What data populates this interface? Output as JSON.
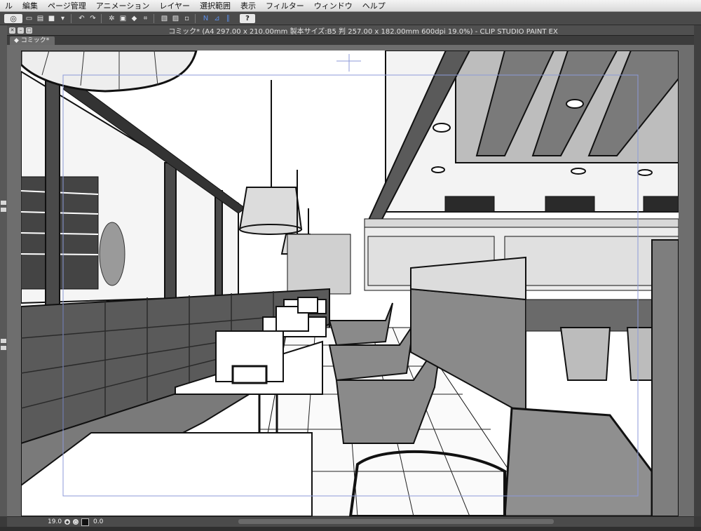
{
  "menu": [
    "ル",
    "編集",
    "ページ管理",
    "アニメーション",
    "レイヤー",
    "選択範囲",
    "表示",
    "フィルター",
    "ウィンドウ",
    "ヘルプ"
  ],
  "window": {
    "title": "コミック* (A4 297.00 x 210.00mm 製本サイズ:B5 判 257.00 x 182.00mm 600dpi 19.0%)  - CLIP STUDIO PAINT EX",
    "tab": "コミック*"
  },
  "status": {
    "zoom": "19.0",
    "angle": "0.0"
  },
  "toolbar": {
    "help": "?"
  },
  "colors": {
    "menubar": "#e6e6e6",
    "toolbar": "#4a4a4a",
    "workspace": "#6e6e6e",
    "canvas": "#ffffff",
    "accent": "#5d8fe8"
  }
}
